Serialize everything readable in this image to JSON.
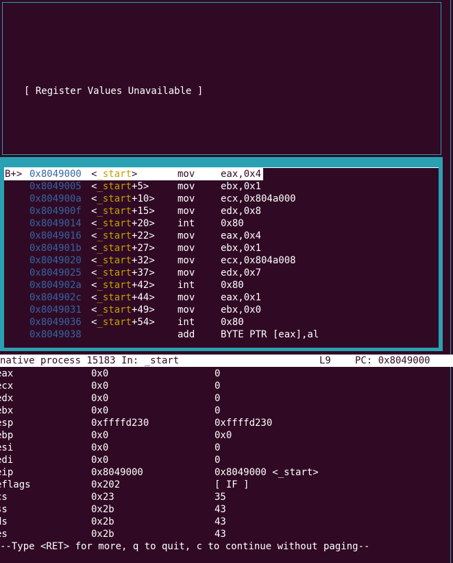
{
  "register_pane": {
    "message": "[ Register Values Unavailable ]"
  },
  "asm_pane": {
    "rows": [
      {
        "mark": "B+>",
        "addr": "0x8049000",
        "sym": "_start",
        "offset": "",
        "op": "mov",
        "args": "eax,0x4",
        "current": true
      },
      {
        "mark": "",
        "addr": "0x8049005",
        "sym": "_start",
        "offset": "+5",
        "op": "mov",
        "args": "ebx,0x1",
        "current": false
      },
      {
        "mark": "",
        "addr": "0x804900a",
        "sym": "_start",
        "offset": "+10",
        "op": "mov",
        "args": "ecx,0x804a000",
        "current": false
      },
      {
        "mark": "",
        "addr": "0x804900f",
        "sym": "_start",
        "offset": "+15",
        "op": "mov",
        "args": "edx,0x8",
        "current": false
      },
      {
        "mark": "",
        "addr": "0x8049014",
        "sym": "_start",
        "offset": "+20",
        "op": "int",
        "args": "0x80",
        "current": false
      },
      {
        "mark": "",
        "addr": "0x8049016",
        "sym": "_start",
        "offset": "+22",
        "op": "mov",
        "args": "eax,0x4",
        "current": false
      },
      {
        "mark": "",
        "addr": "0x804901b",
        "sym": "_start",
        "offset": "+27",
        "op": "mov",
        "args": "ebx,0x1",
        "current": false
      },
      {
        "mark": "",
        "addr": "0x8049020",
        "sym": "_start",
        "offset": "+32",
        "op": "mov",
        "args": "ecx,0x804a008",
        "current": false
      },
      {
        "mark": "",
        "addr": "0x8049025",
        "sym": "_start",
        "offset": "+37",
        "op": "mov",
        "args": "edx,0x7",
        "current": false
      },
      {
        "mark": "",
        "addr": "0x804902a",
        "sym": "_start",
        "offset": "+42",
        "op": "int",
        "args": "0x80",
        "current": false
      },
      {
        "mark": "",
        "addr": "0x804902c",
        "sym": "_start",
        "offset": "+44",
        "op": "mov",
        "args": "eax,0x1",
        "current": false
      },
      {
        "mark": "",
        "addr": "0x8049031",
        "sym": "_start",
        "offset": "+49",
        "op": "mov",
        "args": "ebx,0x0",
        "current": false
      },
      {
        "mark": "",
        "addr": "0x8049036",
        "sym": "_start",
        "offset": "+54",
        "op": "int",
        "args": "0x80",
        "current": false
      },
      {
        "mark": "",
        "addr": "0x8049038",
        "sym": "",
        "offset": "",
        "op": "add",
        "args": "BYTE PTR [eax],al",
        "current": false
      }
    ]
  },
  "status_bar": {
    "process": "native process 15183 In: _start",
    "line": "L9",
    "pc": "PC: 0x8049000"
  },
  "registers": [
    {
      "name": "eax",
      "hex": "0x0",
      "natural": "0"
    },
    {
      "name": "ecx",
      "hex": "0x0",
      "natural": "0"
    },
    {
      "name": "edx",
      "hex": "0x0",
      "natural": "0"
    },
    {
      "name": "ebx",
      "hex": "0x0",
      "natural": "0"
    },
    {
      "name": "esp",
      "hex": "0xffffd230",
      "natural": "0xffffd230"
    },
    {
      "name": "ebp",
      "hex": "0x0",
      "natural": "0x0"
    },
    {
      "name": "esi",
      "hex": "0x0",
      "natural": "0"
    },
    {
      "name": "edi",
      "hex": "0x0",
      "natural": "0"
    },
    {
      "name": "eip",
      "hex": "0x8049000",
      "natural": "0x8049000 <_start>"
    },
    {
      "name": "eflags",
      "hex": "0x202",
      "natural": "[ IF ]"
    },
    {
      "name": "cs",
      "hex": "0x23",
      "natural": "35"
    },
    {
      "name": "ss",
      "hex": "0x2b",
      "natural": "43"
    },
    {
      "name": "ds",
      "hex": "0x2b",
      "natural": "43"
    },
    {
      "name": "es",
      "hex": "0x2b",
      "natural": "43"
    }
  ],
  "pager_prompt": "--Type <RET> for more, q to quit, c to continue without paging--",
  "colors": {
    "background": "#300a24",
    "accent": "#2aa1b3",
    "address": "#3465a4",
    "symbol": "#c4a000"
  }
}
